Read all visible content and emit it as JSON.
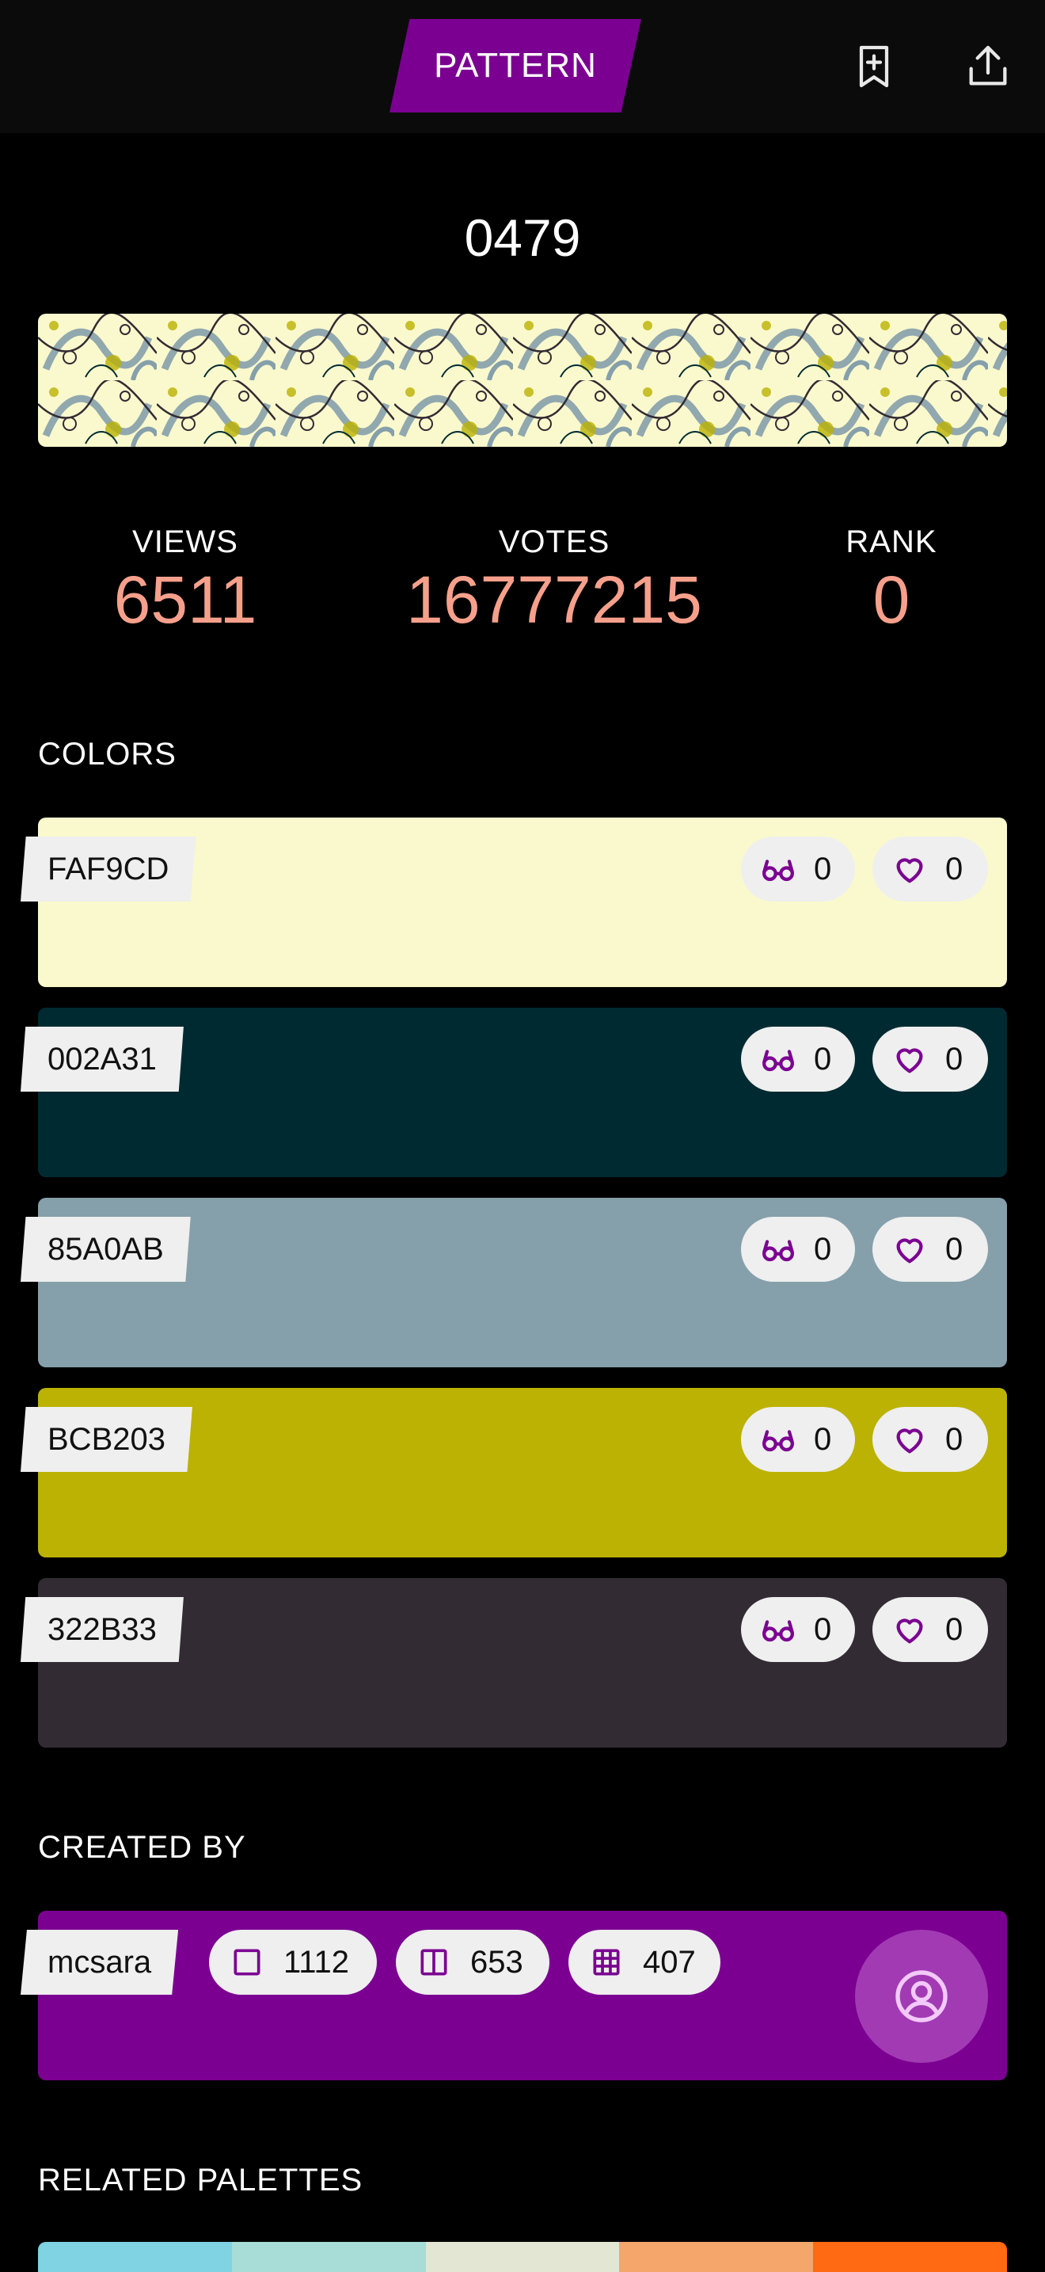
{
  "header": {
    "tab_label": "PATTERN",
    "bookmark_icon": "bookmark-add-icon",
    "share_icon": "share-icon"
  },
  "pattern": {
    "id": "0479"
  },
  "stats": {
    "views": {
      "label": "VIEWS",
      "value": "6511"
    },
    "votes": {
      "label": "VOTES",
      "value": "16777215"
    },
    "rank": {
      "label": "RANK",
      "value": "0"
    }
  },
  "colors_section": {
    "title": "COLORS",
    "items": [
      {
        "hex": "FAF9CD",
        "color": "#FAF9CD",
        "views": "0",
        "likes": "0"
      },
      {
        "hex": "002A31",
        "color": "#002A31",
        "views": "0",
        "likes": "0"
      },
      {
        "hex": "85A0AB",
        "color": "#85A0AB",
        "views": "0",
        "likes": "0"
      },
      {
        "hex": "BCB203",
        "color": "#BCB203",
        "views": "0",
        "likes": "0"
      },
      {
        "hex": "322B33",
        "color": "#322B33",
        "views": "0",
        "likes": "0"
      }
    ]
  },
  "creator_section": {
    "title": "CREATED BY",
    "username": "mcsara",
    "colors_count": "1112",
    "palettes_count": "653",
    "patterns_count": "407",
    "accent": "#7B0091"
  },
  "related_section": {
    "title": "RELATED PALETTES",
    "preview_colors": [
      "#7FD3E3",
      "#A8DCD6",
      "#E2E6D2",
      "#F5A66B",
      "#FF6A13"
    ]
  },
  "theme": {
    "accent": "#7B0091",
    "stat_color": "#F6A08C"
  }
}
